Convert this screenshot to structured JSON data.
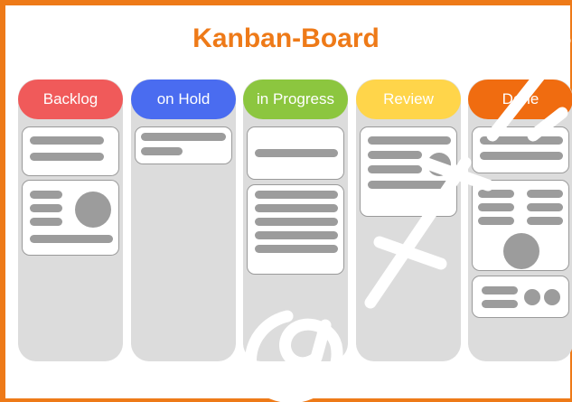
{
  "board": {
    "title": "Kanban-Board",
    "title_color": "#ee7a18",
    "frame_color": "#ee7a18",
    "column_background": "#dcdcdc",
    "card_placeholder_color": "#9c9c9c"
  },
  "columns": [
    {
      "label": "Backlog",
      "color": "#f05a5a"
    },
    {
      "label": "on Hold",
      "color": "#4a6cf0"
    },
    {
      "label": "in Progress",
      "color": "#8cc63f"
    },
    {
      "label": "Review",
      "color": "#ffd54a"
    },
    {
      "label": "Done",
      "color": "#f06c10"
    }
  ],
  "watermark": {
    "shape": "at-sign-and-letters",
    "color": "#000000"
  }
}
